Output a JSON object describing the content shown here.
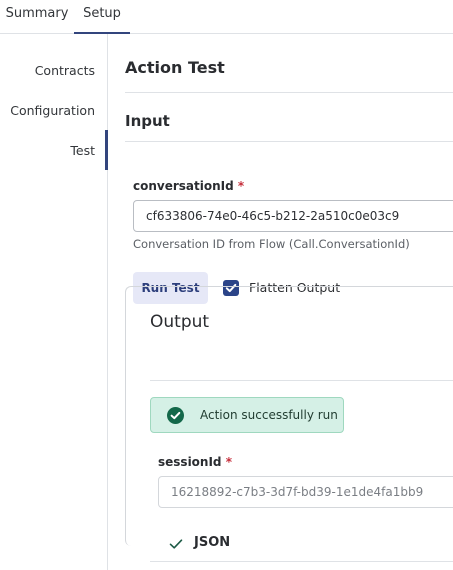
{
  "tabs": [
    {
      "label": "Summary",
      "active": false
    },
    {
      "label": "Setup",
      "active": true
    }
  ],
  "subnav": {
    "items": [
      {
        "label": "Contracts",
        "active": false
      },
      {
        "label": "Configuration",
        "active": false
      },
      {
        "label": "Test",
        "active": true
      }
    ]
  },
  "main": {
    "title": "Action Test",
    "input_heading": "Input",
    "conversation_field": {
      "label": "conversationId",
      "required_mark": "*",
      "value": "cf633806-74e0-46c5-b212-2a510c0e03c9",
      "help": "Conversation ID from Flow (Call.ConversationId)"
    },
    "run_button_label": "Run Test",
    "flatten_output": {
      "label": "Flatten Output",
      "checked": true
    },
    "output": {
      "heading": "Output",
      "success_message": "Action successfully run",
      "session_field": {
        "label": "sessionId",
        "required_mark": "*",
        "value": "16218892-c7b3-3d7f-bd39-1e1de4fa1bb9"
      },
      "json_label": "JSON"
    }
  },
  "colors": {
    "accent": "#33457d",
    "required": "#c62f3c",
    "success_bg": "#d5f0e6",
    "success_icon": "#13684a",
    "button_bg": "#e6e8f7"
  },
  "icons": {
    "success": "check-circle-icon",
    "checkbox": "checkmark-icon",
    "json_toggle": "chevron-check-icon"
  }
}
